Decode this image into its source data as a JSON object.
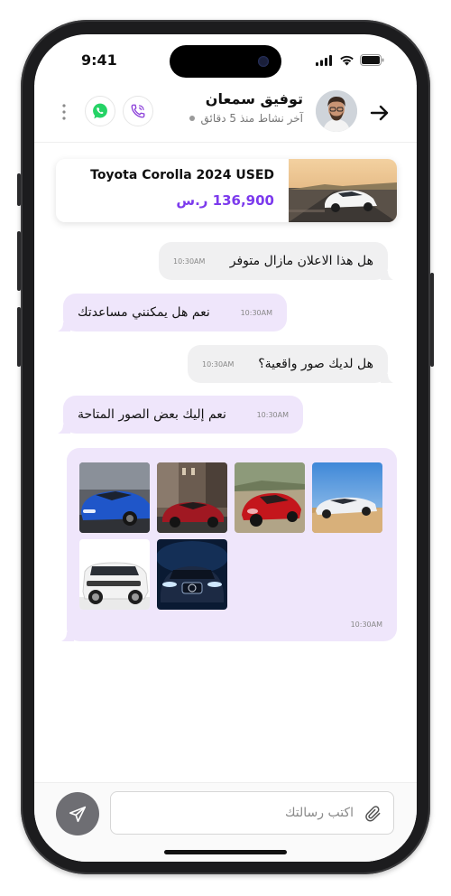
{
  "status_bar": {
    "time": "9:41"
  },
  "header": {
    "contact_name": "توفيق سمعان",
    "last_active": "آخر نشاط منذ 5 دقائق"
  },
  "listing": {
    "title": "Toyota Corolla 2024 USED",
    "price": "136,900 ر.س"
  },
  "messages": [
    {
      "direction": "incoming",
      "text": "هل هذا الاعلان مازال متوفر",
      "time": "10:30AM"
    },
    {
      "direction": "outgoing",
      "text": "نعم هل يمكنني مساعدتك",
      "time": "10:30AM"
    },
    {
      "direction": "incoming",
      "text": "هل لديك صور واقعية؟",
      "time": "10:30AM"
    },
    {
      "direction": "outgoing",
      "text": "نعم إليك بعض الصور المتاحة",
      "time": "10:30AM"
    }
  ],
  "gallery": {
    "time": "10:30AM",
    "photos": [
      "blue-bmw-sedan",
      "red-mercedes-street",
      "red-sports-car",
      "white-sedan-desert",
      "white-range-rover",
      "mercedes-headlights-night"
    ]
  },
  "composer": {
    "placeholder": "اكتب رسالتك"
  },
  "colors": {
    "accent": "#7c3aed",
    "outgoing_bubble": "#efe6fb",
    "incoming_bubble": "#f0f0f1",
    "whatsapp": "#25d366"
  }
}
